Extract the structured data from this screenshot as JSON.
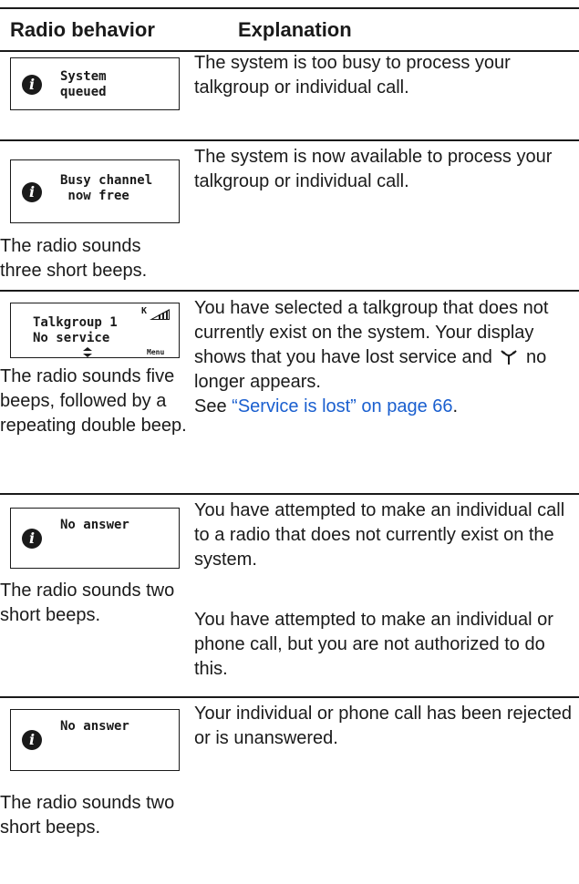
{
  "header": {
    "col1": "Radio behavior",
    "col2": "Explanation"
  },
  "rows": [
    {
      "lcd_text": "System\nqueued",
      "behavior": "",
      "explanation": "The system is too busy to process your talkgroup or individual call."
    },
    {
      "lcd_text": "Busy channel\n now free",
      "behavior": "The radio sounds three short beeps.",
      "explanation": "The system is now available to process your talkgroup or individual call."
    },
    {
      "lcd_line1": "Talkgroup 1",
      "lcd_line2": "No service",
      "lcd_k": "K",
      "lcd_menu": "Menu",
      "behavior": "The radio sounds five beeps, followed by a repeating double beep.",
      "explanation_pre": "You have selected a talkgroup that does not currently exist on the system. Your display shows that you have lost service and",
      "explanation_post": "no longer appears.",
      "see_prefix": "See ",
      "see_link": "“Service is lost” on page 66",
      "see_suffix": "."
    },
    {
      "lcd_text": "No answer",
      "behavior": "The radio sounds two short beeps.",
      "explanation_1": "You have attempted to make an individual call to a radio that does not currently exist on the system.",
      "explanation_2": "You have attempted to make an individual or phone call, but you are not authorized to do this."
    },
    {
      "lcd_text": "No answer",
      "behavior": "The radio sounds two short beeps.",
      "explanation": "Your individual or phone call has been rejected or is unanswered."
    }
  ]
}
